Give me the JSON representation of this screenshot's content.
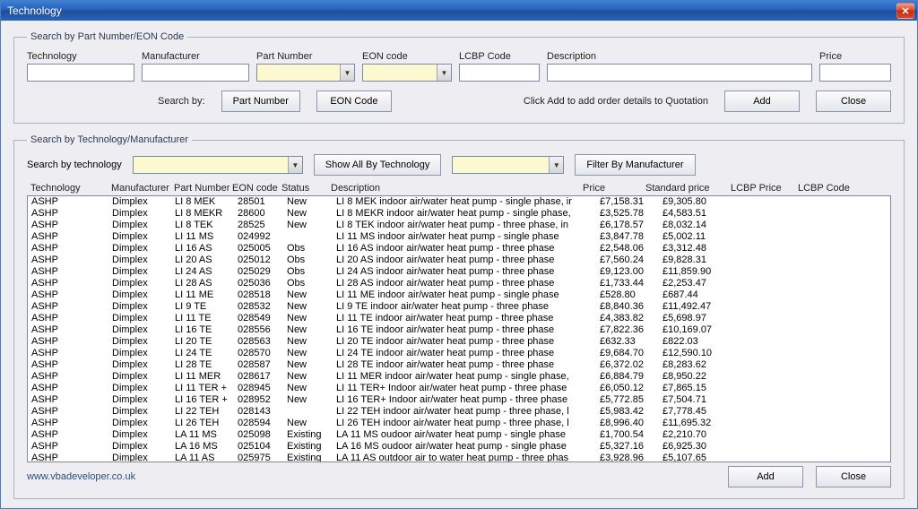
{
  "window": {
    "title": "Technology"
  },
  "top": {
    "legend": "Search by Part Number/EON Code",
    "labels": {
      "technology": "Technology",
      "manufacturer": "Manufacturer",
      "partNumber": "Part Number",
      "eonCode": "EON code",
      "lcbpCode": "LCBP Code",
      "description": "Description",
      "price": "Price",
      "searchBy": "Search by:"
    },
    "buttons": {
      "partNumber": "Part Number",
      "eonCode": "EON Code",
      "add": "Add",
      "close": "Close"
    },
    "hint": "Click Add to add order details to Quotation",
    "values": {
      "technology": "",
      "manufacturer": "",
      "partNumber": "",
      "eonCode": "",
      "lcbpCode": "",
      "description": "",
      "price": ""
    }
  },
  "bottom": {
    "legend": "Search by Technology/Manufacturer",
    "labels": {
      "searchByTechnology": "Search by technology"
    },
    "buttons": {
      "showAll": "Show All By Technology",
      "filter": "Filter By Manufacturer",
      "add": "Add",
      "close": "Close"
    },
    "columns": {
      "technology": "Technology",
      "manufacturer": "Manufacturer",
      "partNumber": "Part Number",
      "eonCode": "EON code",
      "status": "Status",
      "description": "Description",
      "price": "Price",
      "standardPrice": "Standard price",
      "lcbpPrice": "LCBP Price",
      "lcbpCode": "LCBP Code"
    },
    "rows": [
      {
        "tech": "ASHP",
        "mfr": "Dimplex",
        "pn": "LI 8 MEK",
        "eon": "28501",
        "status": "New",
        "desc": "LI 8 MEK indoor air/water heat pump - single phase, ir",
        "price": "£7,158.31",
        "std": "£9,305.80"
      },
      {
        "tech": "ASHP",
        "mfr": "Dimplex",
        "pn": "LI 8 MEKR",
        "eon": "28600",
        "status": "New",
        "desc": "LI 8 MEKR indoor air/water heat pump - single phase,",
        "price": "£3,525.78",
        "std": "£4,583.51"
      },
      {
        "tech": "ASHP",
        "mfr": "Dimplex",
        "pn": "LI 8 TEK",
        "eon": "28525",
        "status": "New",
        "desc": "LI 8 TEK indoor air/water heat pump - three phase, in",
        "price": "£6,178.57",
        "std": "£8,032.14"
      },
      {
        "tech": "ASHP",
        "mfr": "Dimplex",
        "pn": "LI 11 MS",
        "eon": "024992",
        "status": "",
        "desc": "LI 11 MS indoor air/water heat pump - single phase",
        "price": "£3,847.78",
        "std": "£5,002.11"
      },
      {
        "tech": "ASHP",
        "mfr": "Dimplex",
        "pn": "LI 16 AS",
        "eon": "025005",
        "status": "Obs",
        "desc": "LI 16 AS indoor air/water heat pump - three phase",
        "price": "£2,548.06",
        "std": "£3,312.48"
      },
      {
        "tech": "ASHP",
        "mfr": "Dimplex",
        "pn": "LI 20 AS",
        "eon": "025012",
        "status": "Obs",
        "desc": "LI 20 AS indoor air/water heat pump - three phase",
        "price": "£7,560.24",
        "std": "£9,828.31"
      },
      {
        "tech": "ASHP",
        "mfr": "Dimplex",
        "pn": "LI 24 AS",
        "eon": "025029",
        "status": "Obs",
        "desc": "LI 24 AS indoor air/water heat pump - three phase",
        "price": "£9,123.00",
        "std": "£11,859.90"
      },
      {
        "tech": "ASHP",
        "mfr": "Dimplex",
        "pn": "LI 28 AS",
        "eon": "025036",
        "status": "Obs",
        "desc": "LI 28 AS indoor air/water heat pump - three phase",
        "price": "£1,733.44",
        "std": "£2,253.47"
      },
      {
        "tech": "ASHP",
        "mfr": "Dimplex",
        "pn": "LI 11 ME",
        "eon": "028518",
        "status": "New",
        "desc": "LI 11 ME indoor air/water heat pump - single phase",
        "price": "£528.80",
        "std": "£687.44"
      },
      {
        "tech": "ASHP",
        "mfr": "Dimplex",
        "pn": "LI 9 TE",
        "eon": "028532",
        "status": "New",
        "desc": "LI 9 TE indoor air/water heat pump - three phase",
        "price": "£8,840.36",
        "std": "£11,492.47"
      },
      {
        "tech": "ASHP",
        "mfr": "Dimplex",
        "pn": "LI 11 TE",
        "eon": "028549",
        "status": "New",
        "desc": "LI 11 TE indoor air/water heat pump - three phase",
        "price": "£4,383.82",
        "std": "£5,698.97"
      },
      {
        "tech": "ASHP",
        "mfr": "Dimplex",
        "pn": "LI 16 TE",
        "eon": "028556",
        "status": "New",
        "desc": "LI 16 TE indoor air/water heat pump - three phase",
        "price": "£7,822.36",
        "std": "£10,169.07"
      },
      {
        "tech": "ASHP",
        "mfr": "Dimplex",
        "pn": "LI 20 TE",
        "eon": "028563",
        "status": "New",
        "desc": "LI 20 TE indoor air/water heat pump - three phase",
        "price": "£632.33",
        "std": "£822.03"
      },
      {
        "tech": "ASHP",
        "mfr": "Dimplex",
        "pn": "LI 24 TE",
        "eon": "028570",
        "status": "New",
        "desc": "LI 24 TE indoor air/water heat pump - three phase",
        "price": "£9,684.70",
        "std": "£12,590.10"
      },
      {
        "tech": "ASHP",
        "mfr": "Dimplex",
        "pn": "LI 28 TE",
        "eon": "028587",
        "status": "New",
        "desc": "LI 28 TE indoor air/water heat pump - three phase",
        "price": "£6,372.02",
        "std": "£8,283.62"
      },
      {
        "tech": "ASHP",
        "mfr": "Dimplex",
        "pn": "LI 11 MER",
        "eon": "028617",
        "status": "New",
        "desc": "LI 11 MER indoor air/water heat pump - single phase,",
        "price": "£6,884.79",
        "std": "£8,950.22"
      },
      {
        "tech": "ASHP",
        "mfr": "Dimplex",
        "pn": "LI 11 TER +",
        "eon": "028945",
        "status": "New",
        "desc": "LI 11 TER+ Indoor air/water heat pump - three phase",
        "price": "£6,050.12",
        "std": "£7,865.15"
      },
      {
        "tech": "ASHP",
        "mfr": "Dimplex",
        "pn": "LI 16 TER +",
        "eon": "028952",
        "status": "New",
        "desc": "LI 16 TER+ Indoor air/water heat pump - three phase",
        "price": "£5,772.85",
        "std": "£7,504.71"
      },
      {
        "tech": "ASHP",
        "mfr": "Dimplex",
        "pn": "LI 22 TEH",
        "eon": "028143",
        "status": "",
        "desc": "LI 22 TEH indoor air/water heat pump - three phase, l",
        "price": "£5,983.42",
        "std": "£7,778.45"
      },
      {
        "tech": "ASHP",
        "mfr": "Dimplex",
        "pn": "LI 26 TEH",
        "eon": "028594",
        "status": "New",
        "desc": "LI 26 TEH indoor air/water heat pump - three phase, l",
        "price": "£8,996.40",
        "std": "£11,695.32"
      },
      {
        "tech": "ASHP",
        "mfr": "Dimplex",
        "pn": "LA 11 MS",
        "eon": "025098",
        "status": "Existing",
        "desc": "LA 11 MS oudoor air/water heat pump - single phase",
        "price": "£1,700.54",
        "std": "£2,210.70"
      },
      {
        "tech": "ASHP",
        "mfr": "Dimplex",
        "pn": "LA 16 MS",
        "eon": "025104",
        "status": "Existing",
        "desc": "LA 16 MS oudoor air/water heat pump - single phase",
        "price": "£5,327.16",
        "std": "£6,925.30"
      },
      {
        "tech": "ASHP",
        "mfr": "Dimplex",
        "pn": "LA 11 AS",
        "eon": "025975",
        "status": "Existing",
        "desc": "LA 11 AS outdoor air to water heat pump - three phas",
        "price": "£3,928.96",
        "std": "£5,107.65"
      }
    ]
  },
  "footer": {
    "url": "www.vbadeveloper.co.uk"
  }
}
